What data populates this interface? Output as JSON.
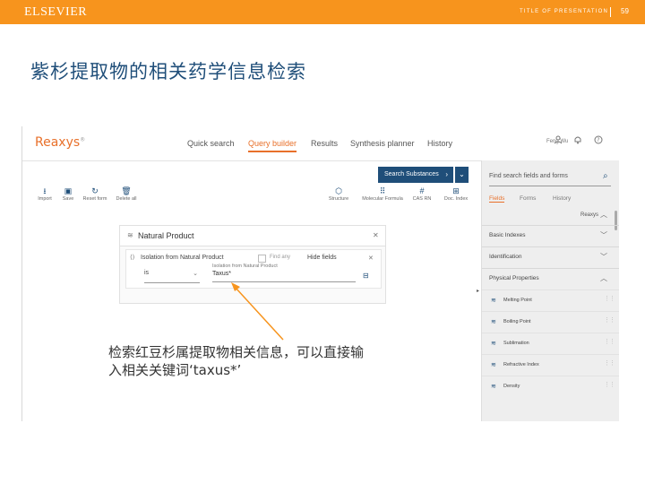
{
  "banner": {
    "brand": "ELSEVIER",
    "presentation_title": "TITLE OF PRESENTATION",
    "page_number": "59",
    "color": "#f7941d"
  },
  "slide": {
    "title": "紫杉提取物的相关药学信息检索"
  },
  "app": {
    "logo": "Reaxys",
    "logo_mark": "®",
    "nav": [
      "Quick search",
      "Query builder",
      "Results",
      "Synthesis planner",
      "History"
    ],
    "active_nav": "Query builder",
    "user": "Feng Wu",
    "accent": "#e8702a",
    "primary": "#1f4e79"
  },
  "toolbar": {
    "search_button": "Search Substances",
    "left_tools": [
      "Import",
      "Save",
      "Reset form",
      "Delete all"
    ],
    "right_tools": [
      "Structure",
      "Molecular Formula",
      "CAS RN",
      "Doc. Index"
    ]
  },
  "query_panel": {
    "title": "Natural Product",
    "row_label": "Isolation from Natural Product",
    "find_any": "Find any",
    "hide_fields": "Hide fields",
    "operator": "is",
    "value_label": "Isolation from Natural Product",
    "value": "Taxus*"
  },
  "side_panel": {
    "find_placeholder": "Find search fields and forms",
    "tabs": [
      "Fields",
      "Forms",
      "History"
    ],
    "active_tab": "Fields",
    "source": "Reaxys",
    "sections": [
      "Basic Indexes",
      "Identification",
      "Physical Properties"
    ],
    "items": [
      "Melting Point",
      "Boiling Point",
      "Sublimation",
      "Refractive Index",
      "Density"
    ]
  },
  "annotation": {
    "line1": "检索红豆杉属提取物相关信息，可以直接输",
    "line2": "入相关关键词‘taxus*’",
    "arrow_color": "#f7941d"
  }
}
